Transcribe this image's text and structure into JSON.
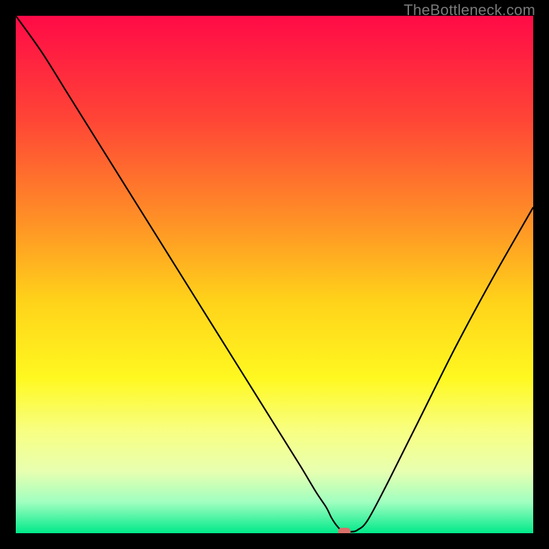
{
  "watermark": "TheBottleneck.com",
  "chart_data": {
    "type": "line",
    "title": "",
    "xlabel": "",
    "ylabel": "",
    "xlim": [
      0,
      100
    ],
    "ylim": [
      0,
      100
    ],
    "grid": false,
    "background": {
      "type": "vertical-gradient",
      "stops": [
        {
          "pos": 0,
          "color": "#ff0a47"
        },
        {
          "pos": 20,
          "color": "#ff4536"
        },
        {
          "pos": 40,
          "color": "#ff9226"
        },
        {
          "pos": 55,
          "color": "#ffd21a"
        },
        {
          "pos": 70,
          "color": "#fff820"
        },
        {
          "pos": 80,
          "color": "#f8ff80"
        },
        {
          "pos": 88,
          "color": "#e8ffb0"
        },
        {
          "pos": 94,
          "color": "#a0ffc0"
        },
        {
          "pos": 100,
          "color": "#00e98a"
        }
      ]
    },
    "series": [
      {
        "name": "bottleneck-curve",
        "color": "#000000",
        "x": [
          0,
          5,
          10,
          15,
          20,
          25,
          30,
          35,
          40,
          45,
          50,
          55,
          58,
          60,
          61,
          62,
          63,
          64,
          65,
          66,
          68,
          72,
          78,
          85,
          92,
          100
        ],
        "y": [
          100,
          93,
          85,
          77,
          69,
          61,
          53,
          45,
          37,
          29,
          21,
          13,
          8,
          5,
          3,
          1.5,
          0.5,
          0.3,
          0.3,
          0.6,
          2.5,
          10,
          22,
          36,
          49,
          63
        ]
      }
    ],
    "marker": {
      "name": "optimal-point",
      "x": 63.5,
      "y": 0.3,
      "color": "#d96f6a",
      "shape": "rounded-rect",
      "width": 2.4,
      "height": 1.5
    }
  }
}
